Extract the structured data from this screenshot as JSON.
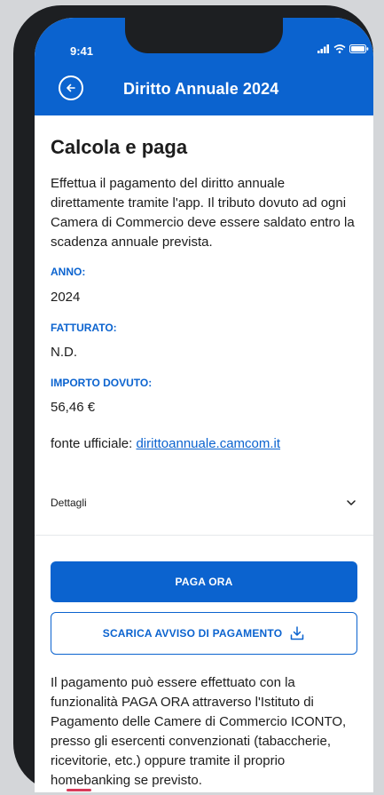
{
  "status_bar": {
    "time": "9:41"
  },
  "header": {
    "title": "Diritto Annuale 2024"
  },
  "page": {
    "title": "Calcola e paga",
    "intro": "Effettua il pagamento del diritto annuale direttamente tramite l'app. Il tributo dovuto ad ogni Camera di Commercio deve essere saldato entro la scadenza annuale prevista."
  },
  "fields": {
    "anno": {
      "label": "ANNO:",
      "value": "2024"
    },
    "fatturato": {
      "label": "FATTURATO:",
      "value": "N.D."
    },
    "importo": {
      "label": "IMPORTO DOVUTO:",
      "value": "56,46 €"
    }
  },
  "source": {
    "prefix": "fonte ufficiale:",
    "link": "dirittoannuale.camcom.it"
  },
  "details": {
    "label": "Dettagli"
  },
  "buttons": {
    "pay_now": "PAGA ORA",
    "download_notice": "SCARICA AVVISO DI PAGAMENTO"
  },
  "footer": {
    "text": "Il pagamento può essere effettuato con la funzionalità PAGA ORA attraverso l'Istituto di Pagamento delle Camere di Commercio ICONTO, presso gli esercenti convenzionati (tabaccherie, ricevitorie, etc.) oppure tramite il proprio homebanking se previsto."
  },
  "colors": {
    "primary": "#0b63cf",
    "text": "#1c1c1c",
    "phone_frame": "#1d1f22"
  },
  "icons": [
    "signal-icon",
    "wifi-icon",
    "battery-icon",
    "back-arrow-icon",
    "chevron-down-icon",
    "download-icon"
  ]
}
